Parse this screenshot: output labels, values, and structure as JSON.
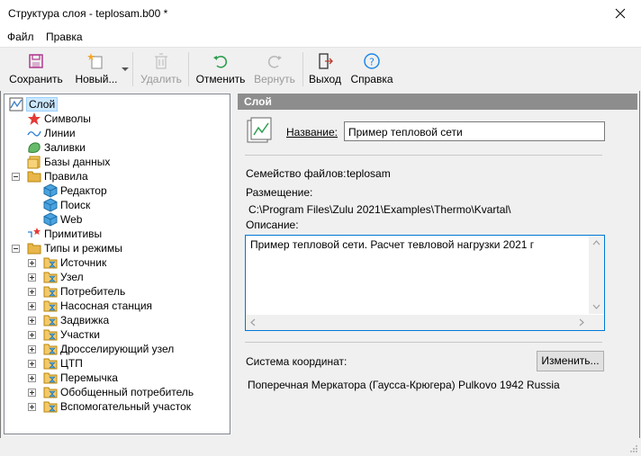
{
  "window": {
    "title": "Структура слоя - teplosam.b00 *"
  },
  "menu": {
    "file": "Файл",
    "edit": "Правка"
  },
  "toolbar": {
    "save": "Сохранить",
    "new": "Новый...",
    "delete": "Удалить",
    "undo": "Отменить",
    "redo": "Вернуть",
    "exit": "Выход",
    "help": "Справка"
  },
  "tree": {
    "root": "Слой",
    "symbols": "Символы",
    "lines": "Линии",
    "fills": "Заливки",
    "databases": "Базы данных",
    "rules": "Правила",
    "editor": "Редактор",
    "search": "Поиск",
    "web": "Web",
    "primitives": "Примитивы",
    "types": "Типы и режимы",
    "type_items": [
      "Источник",
      "Узел",
      "Потребитель",
      "Насосная станция",
      "Задвижка",
      "Участки",
      "Дросселирующий узел",
      "ЦТП",
      "Перемычка",
      "Обобщенный потребитель",
      "Вспомогательный участок"
    ]
  },
  "panel": {
    "header": "Слой",
    "name_label": "Название:",
    "name_value": "Пример тепловой сети",
    "family_label": "Семейство файлов:",
    "family_value": "teplosam",
    "location_label": "Размещение:",
    "location_value": "C:\\Program Files\\Zulu 2021\\Examples\\Thermo\\Kvartal\\",
    "description_label": "Описание:",
    "description_value": "Пример тепловой сети. Расчет тевловой нагрузки 2021 г",
    "coord_label": "Система координат:",
    "change_button": "Изменить...",
    "coord_value": "Поперечная Меркатора (Гаусса-Крюгера) Pulkovo 1942 Russia"
  },
  "colors": {
    "selection": "#cce8ff",
    "header_bg": "#8d8d8d",
    "focus_border": "#0078d7",
    "folder": "#e8b64a",
    "cube": "#4aa3df"
  }
}
